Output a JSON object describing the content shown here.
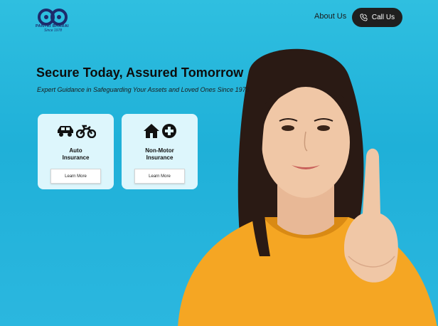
{
  "header": {
    "logo_text": "PANTRI BHARAI",
    "logo_sub": "Since 1978",
    "nav_about": "About Us",
    "call_label": "Call Us"
  },
  "hero": {
    "title": "Secure Today, Assured Tomorrow",
    "subtitle": "Expert Guidance in Safeguarding Your Assets and Loved Ones Since 1978"
  },
  "cards": [
    {
      "label_line1": "Auto",
      "label_line2": "Insurance",
      "button": "Learn More",
      "icons": [
        "car-icon",
        "motorcycle-icon"
      ]
    },
    {
      "label_line1": "Non-Motor",
      "label_line2": "Insurance",
      "button": "Learn More",
      "icons": [
        "house-icon",
        "medical-cross-icon"
      ]
    }
  ],
  "colors": {
    "background": "#2fbfe0",
    "card": "#ddf6fc",
    "call_button": "#1f1f1f",
    "shirt": "#f5a623"
  }
}
